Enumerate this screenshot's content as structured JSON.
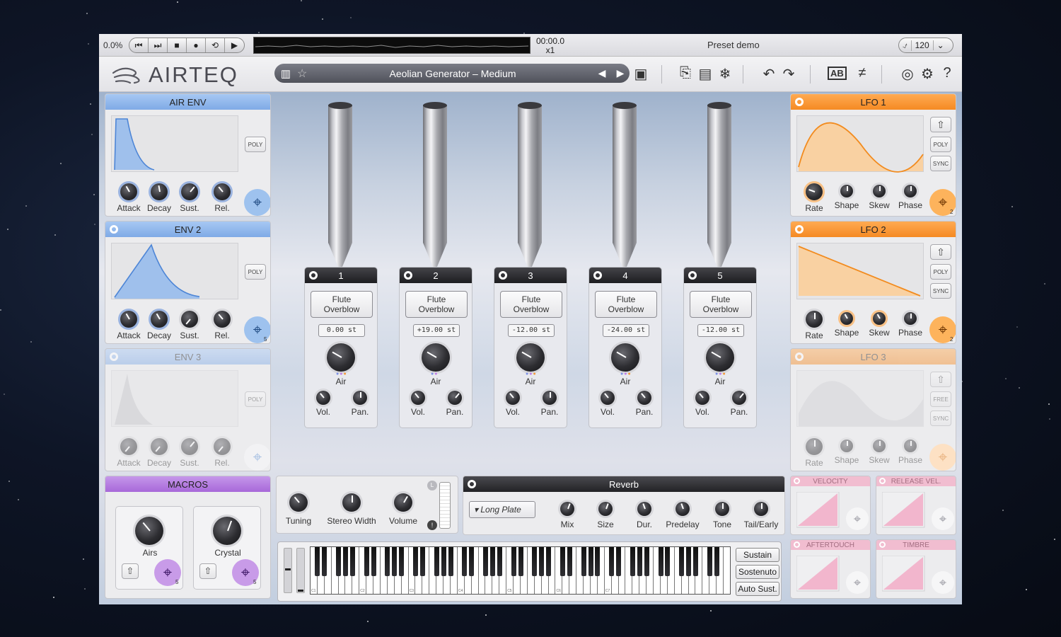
{
  "transport": {
    "cpu": "0.0%",
    "buttons": [
      "⏮",
      "⏭",
      "■",
      "●",
      "⟲",
      "▶"
    ],
    "time": "00:00.0",
    "speed": "x1",
    "preset_label": "Preset demo",
    "bpm_icon": "metronome-icon",
    "bpm": "120"
  },
  "header": {
    "logo": "AIRTEQ",
    "preset_name": "Aeolian Generator – Medium"
  },
  "envelopes": [
    {
      "title": "AIR ENV",
      "poly": "POLY",
      "knobs": [
        "Attack",
        "Decay",
        "Sust.",
        "Rel."
      ]
    },
    {
      "title": "ENV 2",
      "poly": "POLY",
      "knobs": [
        "Attack",
        "Decay",
        "Sust.",
        "Rel."
      ],
      "mod_count": "5"
    },
    {
      "title": "ENV 3",
      "poly": "POLY",
      "knobs": [
        "Attack",
        "Decay",
        "Sust.",
        "Rel."
      ]
    }
  ],
  "lfos": [
    {
      "title": "LFO 1",
      "mode": "POLY",
      "sync": "SYNC",
      "knobs": [
        "Rate",
        "Shape",
        "Skew",
        "Phase"
      ],
      "mod_count": "2"
    },
    {
      "title": "LFO 2",
      "mode": "POLY",
      "sync": "SYNC",
      "knobs": [
        "Rate",
        "Shape",
        "Skew",
        "Phase"
      ],
      "mod_count": "2"
    },
    {
      "title": "LFO 3",
      "mode": "FREE",
      "sync": "SYNC",
      "knobs": [
        "Rate",
        "Shape",
        "Skew",
        "Phase"
      ]
    }
  ],
  "voices": [
    {
      "num": "1",
      "type_line1": "Flute",
      "type_line2": "Overblow",
      "tune": "0.00 st",
      "air": "Air",
      "vol": "Vol.",
      "pan": "Pan."
    },
    {
      "num": "2",
      "type_line1": "Flute",
      "type_line2": "Overblow",
      "tune": "+19.00 st",
      "air": "Air",
      "vol": "Vol.",
      "pan": "Pan."
    },
    {
      "num": "3",
      "type_line1": "Flute",
      "type_line2": "Overblow",
      "tune": "-12.00 st",
      "air": "Air",
      "vol": "Vol.",
      "pan": "Pan."
    },
    {
      "num": "4",
      "type_line1": "Flute",
      "type_line2": "Overblow",
      "tune": "-24.00 st",
      "air": "Air",
      "vol": "Vol.",
      "pan": "Pan."
    },
    {
      "num": "5",
      "type_line1": "Flute",
      "type_line2": "Overblow",
      "tune": "-12.00 st",
      "air": "Air",
      "vol": "Vol.",
      "pan": "Pan."
    }
  ],
  "macros": {
    "title": "MACROS",
    "items": [
      {
        "label": "Airs",
        "count": "5"
      },
      {
        "label": "Crystal",
        "count": "5"
      }
    ]
  },
  "global": {
    "knobs": [
      "Tuning",
      "Stereo Width",
      "Volume"
    ],
    "meter_top": "L"
  },
  "reverb": {
    "title": "Reverb",
    "type": "Long Plate",
    "knobs": [
      "Mix",
      "Size",
      "Dur.",
      "Predelay",
      "Tone",
      "Tail/Early"
    ]
  },
  "keyboard": {
    "octave_labels": [
      "C1",
      "C2",
      "C3",
      "C4",
      "C5",
      "C6",
      "C7"
    ],
    "pedals": [
      "Sustain",
      "Sostenuto",
      "Auto Sust."
    ]
  },
  "modulators": [
    "VELOCITY",
    "RELEASE VEL.",
    "AFTERTOUCH",
    "TIMBRE"
  ]
}
